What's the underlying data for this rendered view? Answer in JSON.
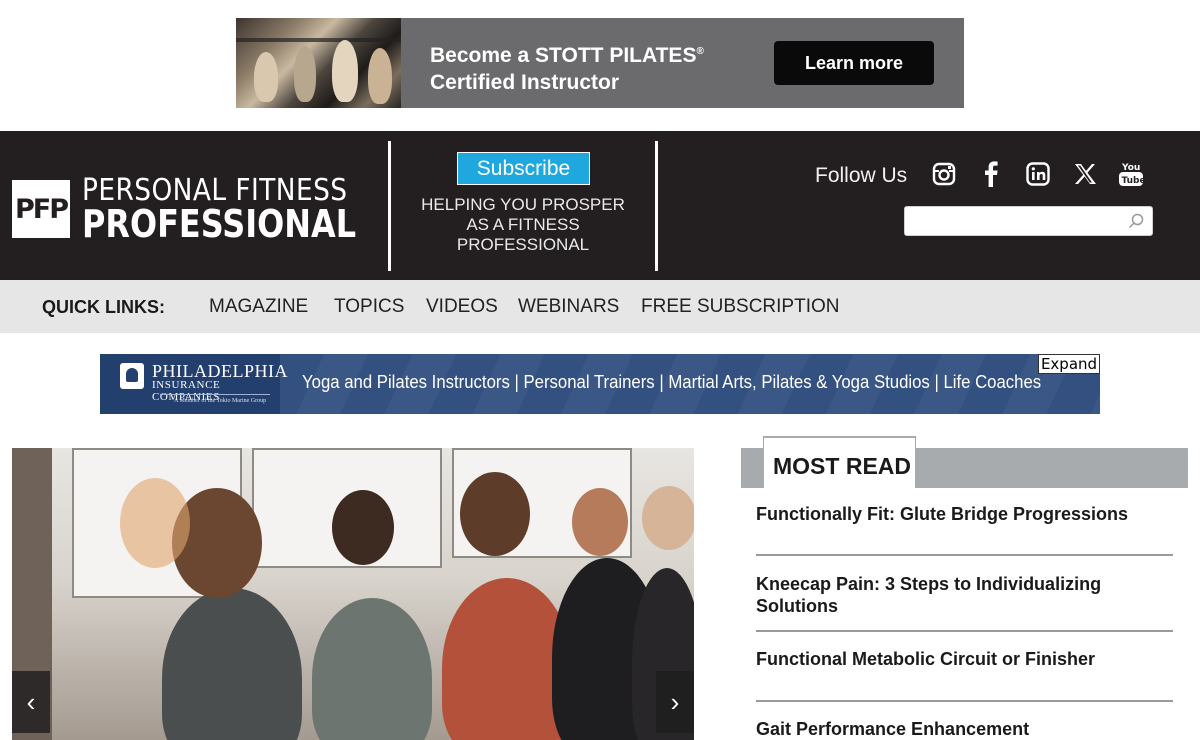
{
  "top_ad": {
    "headline_line1": "Become a STOTT PILATES",
    "registered": "®",
    "headline_line2": "Certified Instructor",
    "cta": "Learn more"
  },
  "header": {
    "logo_mark": "PFP",
    "logo_line1": "PERSONAL FITNESS",
    "logo_line2": "PROFESSIONAL",
    "subscribe_label": "Subscribe",
    "tagline": "HELPING YOU PROSPER AS A FITNESS PROFESSIONAL",
    "follow_label": "Follow Us",
    "social_icons": [
      "instagram-icon",
      "facebook-icon",
      "linkedin-icon",
      "x-icon",
      "youtube-icon"
    ],
    "search_placeholder": ""
  },
  "quick_links": {
    "label": "QUICK LINKS:",
    "items": [
      "MAGAZINE",
      "TOPICS",
      "VIDEOS",
      "WEBINARS",
      "FREE SUBSCRIPTION"
    ]
  },
  "insurance_ad": {
    "company_line1": "PHILADELPHIA",
    "company_line2": "INSURANCE COMPANIES",
    "company_line3": "A Member of the Tokio Marine Group",
    "text": "Yoga and Pilates Instructors | Personal Trainers | Martial Arts, Pilates & Yoga Studios | Life Coaches",
    "expand_label": "Expand"
  },
  "hero": {
    "prev": "‹",
    "next": "›"
  },
  "most_read": {
    "title": "MOST READ",
    "items": [
      "Functionally Fit: Glute Bridge Progressions",
      "Kneecap Pain: 3 Steps to Individualizing Solutions",
      "Functional Metabolic Circuit or Finisher",
      "Gait Performance Enhancement"
    ]
  },
  "colors": {
    "header_bg": "#231f20",
    "subscribe_bg": "#1fa8dd",
    "quick_links_bg": "#e6e6e6",
    "ad_bg": "#6b6a6c",
    "insurance_bg": "#2c4a7c",
    "most_read_bar": "#a7abae"
  }
}
